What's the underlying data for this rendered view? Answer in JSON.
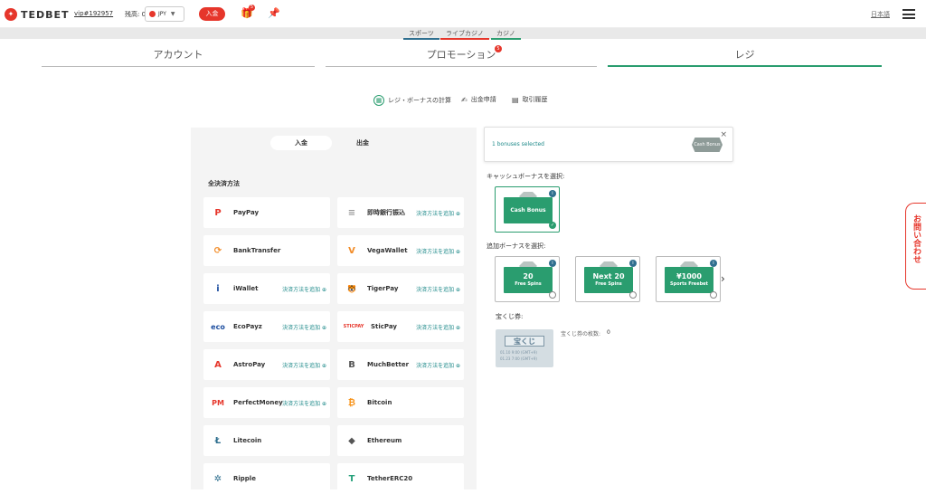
{
  "header": {
    "logo_text": "TEDBET",
    "vip_id": "vip#192957",
    "balance_label": "残高: 0",
    "currency": "JPY",
    "deposit_label": "入金",
    "gift_badge": "5",
    "language": "日本語"
  },
  "subnav": [
    {
      "label": "スポーツ",
      "color": "#2f6f8f"
    },
    {
      "label": "ライブカジノ",
      "color": "#e6362b"
    },
    {
      "label": "カジノ",
      "color": "#2a9d6f"
    }
  ],
  "main_tabs": [
    {
      "label": "アカウント"
    },
    {
      "label": "プロモーション",
      "badge": "5"
    },
    {
      "label": "レジ",
      "active": true
    }
  ],
  "submenu": [
    {
      "label": "レジ・ボーナスの計算"
    },
    {
      "label": "出金申請"
    },
    {
      "label": "取引履歴"
    }
  ],
  "toggle": {
    "deposit": "入金",
    "withdraw": "出金"
  },
  "section_title": "全決済方法",
  "add_method_label": "決済方法を追加 ⊕",
  "methods_left": [
    {
      "name": "PayPay",
      "logo": "P",
      "color": "#e6362b",
      "add": false
    },
    {
      "name": "BankTransfer",
      "logo": "⟳",
      "color": "#f28c28",
      "add": false
    },
    {
      "name": "iWallet",
      "logo": "i",
      "color": "#1f4fa0",
      "add": true
    },
    {
      "name": "EcoPayz",
      "logo": "eco",
      "color": "#1f4fa0",
      "add": true
    },
    {
      "name": "AstroPay",
      "logo": "A",
      "color": "#e6362b",
      "add": true
    },
    {
      "name": "PerfectMoney",
      "logo": "PM",
      "color": "#e6362b",
      "add": true
    },
    {
      "name": "Litecoin",
      "logo": "Ł",
      "color": "#2f6f8f",
      "add": false
    },
    {
      "name": "Ripple",
      "logo": "✲",
      "color": "#2f6f8f",
      "add": false
    }
  ],
  "methods_right": [
    {
      "name": "即時銀行振込",
      "logo": "≡",
      "color": "#999999",
      "add": true
    },
    {
      "name": "VegaWallet",
      "logo": "V",
      "color": "#f28c28",
      "add": true
    },
    {
      "name": "TigerPay",
      "logo": "🐯",
      "color": "#e0a800",
      "add": true
    },
    {
      "name": "SticPay",
      "logo": "STICPAY",
      "color": "#e6362b",
      "add": true
    },
    {
      "name": "MuchBetter",
      "logo": "B",
      "color": "#555555",
      "add": true
    },
    {
      "name": "Bitcoin",
      "logo": "₿",
      "color": "#f7931a",
      "add": false
    },
    {
      "name": "Ethereum",
      "logo": "◆",
      "color": "#555555",
      "add": false
    },
    {
      "name": "TetherERC20",
      "logo": "T",
      "color": "#26a17b",
      "add": false
    }
  ],
  "bonus_selected": {
    "text": "1 bonuses selected",
    "badge": "Cash Bonus",
    "close": "×"
  },
  "cash_bonus_label": "キャッシュボーナスを選択:",
  "cash_bonus": {
    "title": "Cash Bonus"
  },
  "extra_bonus_label": "追加ボーナスを選択:",
  "extra_bonuses": [
    {
      "big": "20",
      "small": "Free Spins"
    },
    {
      "big": "Next 20",
      "small": "Free Spins"
    },
    {
      "big": "¥1000",
      "small": "Sports Freebet"
    }
  ],
  "lottery_label": "宝くじ券:",
  "lottery": {
    "title": "宝くじ",
    "date1": "01.10 9:00 (GMT+9)",
    "date2": "01.23 7:00 (GMT+9)",
    "count_label": "宝くじ券の枚数:",
    "count": "0"
  },
  "contact_label": "お問い合わせ"
}
